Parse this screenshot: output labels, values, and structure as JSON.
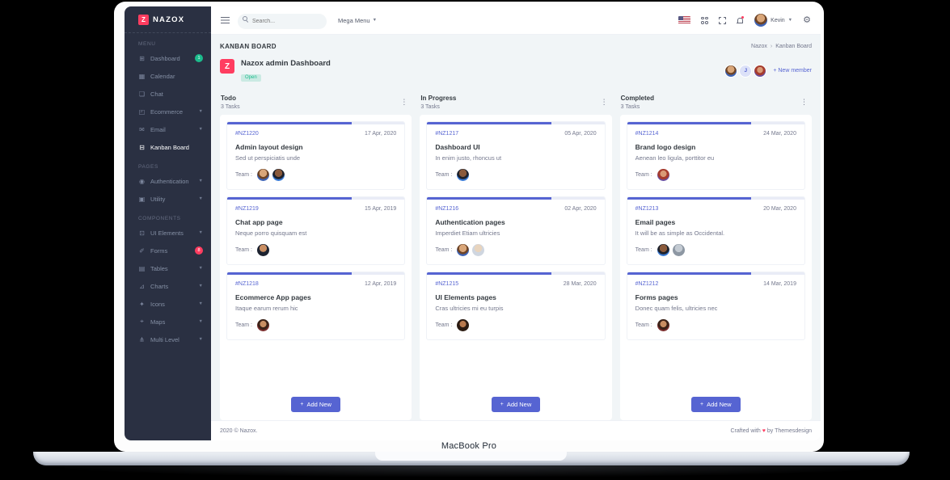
{
  "device": {
    "label": "MacBook Pro"
  },
  "colors": {
    "primary": "#5664d2",
    "sidebar_bg": "#2a3042",
    "success": "#1cbb8c",
    "danger": "#ff3d60",
    "body_bg": "#f1f5f7"
  },
  "sidebar": {
    "logo": "NAZOX",
    "sections": [
      {
        "label": "MENU",
        "items": [
          {
            "label": "Dashboard",
            "icon": "dashboard-icon",
            "badge": "1",
            "badge_color": "#1cbb8c"
          },
          {
            "label": "Calendar",
            "icon": "calendar-icon"
          },
          {
            "label": "Chat",
            "icon": "chat-icon"
          },
          {
            "label": "Ecommerce",
            "icon": "ecommerce-icon",
            "chevron": true
          },
          {
            "label": "Email",
            "icon": "email-icon",
            "chevron": true
          },
          {
            "label": "Kanban Board",
            "icon": "kanban-icon",
            "active": true
          }
        ]
      },
      {
        "label": "PAGES",
        "items": [
          {
            "label": "Authentication",
            "icon": "authentication-icon",
            "chevron": true
          },
          {
            "label": "Utility",
            "icon": "utility-icon",
            "chevron": true
          }
        ]
      },
      {
        "label": "COMPONENTS",
        "items": [
          {
            "label": "UI Elements",
            "icon": "ui-elements-icon",
            "chevron": true
          },
          {
            "label": "Forms",
            "icon": "forms-icon",
            "badge": "8",
            "badge_color": "#ff3d60"
          },
          {
            "label": "Tables",
            "icon": "tables-icon",
            "chevron": true
          },
          {
            "label": "Charts",
            "icon": "charts-icon",
            "chevron": true
          },
          {
            "label": "Icons",
            "icon": "icons-icon",
            "chevron": true
          },
          {
            "label": "Maps",
            "icon": "maps-icon",
            "chevron": true
          },
          {
            "label": "Multi Level",
            "icon": "multi-level-icon",
            "chevron": true
          }
        ]
      }
    ]
  },
  "topbar": {
    "search_placeholder": "Search...",
    "mega_menu_label": "Mega Menu",
    "user_name": "Kevin"
  },
  "page": {
    "title": "KANBAN BOARD",
    "breadcrumb": [
      "Nazox",
      "Kanban Board"
    ],
    "board": {
      "title": "Nazox admin Dashboard",
      "status": "Open",
      "members": [
        "m1",
        "J",
        "w3"
      ],
      "new_member_label": "+ New member"
    }
  },
  "labels": {
    "team": "Team :",
    "add_new": "Add New"
  },
  "columns": [
    {
      "title": "Todo",
      "tasks_label": "3 Tasks",
      "cards": [
        {
          "id": "#NZ1220",
          "date": "17 Apr, 2020",
          "title": "Admin layout design",
          "desc": "Sed ut perspiciatis unde",
          "team": [
            "m1",
            "m2"
          ],
          "progress": 70
        },
        {
          "id": "#NZ1219",
          "date": "15 Apr, 2019",
          "title": "Chat app page",
          "desc": "Neque porro quisquam est",
          "team": [
            "m3"
          ],
          "progress": 70
        },
        {
          "id": "#NZ1218",
          "date": "12 Apr, 2019",
          "title": "Ecommerce App pages",
          "desc": "Itaque earum rerum hic",
          "team": [
            "w1"
          ],
          "progress": 70
        }
      ]
    },
    {
      "title": "In Progress",
      "tasks_label": "3 Tasks",
      "cards": [
        {
          "id": "#NZ1217",
          "date": "05 Apr, 2020",
          "title": "Dashboard UI",
          "desc": "In enim justo, rhoncus ut",
          "team": [
            "m2"
          ],
          "progress": 70
        },
        {
          "id": "#NZ1216",
          "date": "02 Apr, 2020",
          "title": "Authentication pages",
          "desc": "Imperdiet Etiam ultricies",
          "team": [
            "m1",
            "m4"
          ],
          "progress": 70
        },
        {
          "id": "#NZ1215",
          "date": "28 Mar, 2020",
          "title": "UI Elements pages",
          "desc": "Cras ultricies mi eu turpis",
          "team": [
            "w2"
          ],
          "progress": 70
        }
      ]
    },
    {
      "title": "Completed",
      "tasks_label": "3 Tasks",
      "cards": [
        {
          "id": "#NZ1214",
          "date": "24 Mar, 2020",
          "title": "Brand logo design",
          "desc": "Aenean leo ligula, porttitor eu",
          "team": [
            "w3"
          ],
          "progress": 70
        },
        {
          "id": "#NZ1213",
          "date": "20 Mar, 2020",
          "title": "Email pages",
          "desc": "It will be as simple as Occidental.",
          "team": [
            "m2",
            "m5"
          ],
          "progress": 70
        },
        {
          "id": "#NZ1212",
          "date": "14 Mar, 2019",
          "title": "Forms pages",
          "desc": "Donec quam felis, ultricies nec",
          "team": [
            "w1"
          ],
          "progress": 70
        }
      ]
    }
  ],
  "footer": {
    "left": "2020 © Nazox.",
    "right_prefix": "Crafted with",
    "heart": "♥",
    "right_suffix": "by Themesdesign"
  }
}
